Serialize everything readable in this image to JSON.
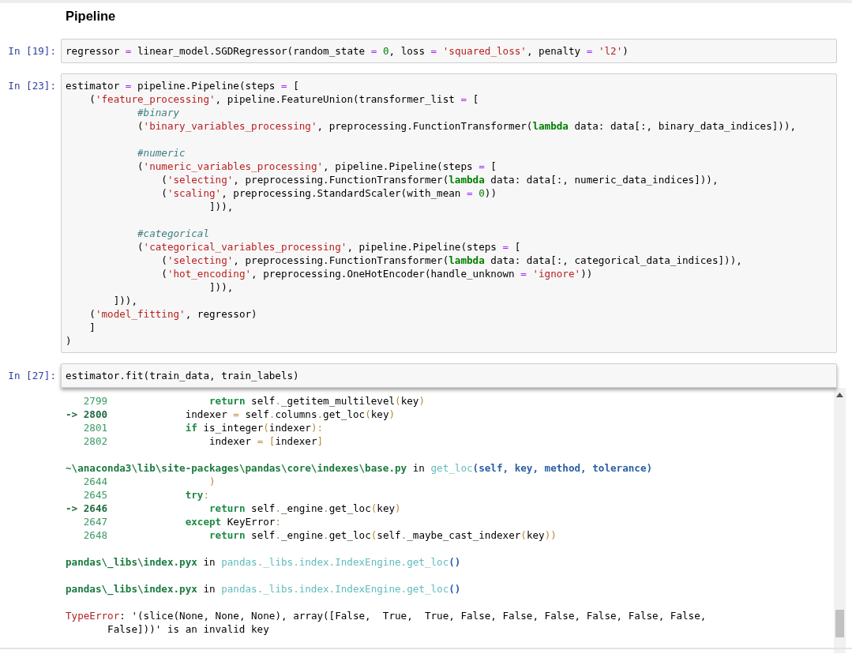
{
  "heading": "Pipeline",
  "cells": [
    {
      "prompt": "In [19]:",
      "code": "regressor = linear_model.SGDRegressor(random_state = 0, loss = 'squared_loss', penalty = 'l2')"
    },
    {
      "prompt": "In [23]:",
      "code": "estimator = pipeline.Pipeline(steps = [\n    ('feature_processing', pipeline.FeatureUnion(transformer_list = [\n            #binary\n            ('binary_variables_processing', preprocessing.FunctionTransformer(lambda data: data[:, binary_data_indices])),\n\n            #numeric\n            ('numeric_variables_processing', pipeline.Pipeline(steps = [\n                ('selecting', preprocessing.FunctionTransformer(lambda data: data[:, numeric_data_indices])),\n                ('scaling', preprocessing.StandardScaler(with_mean = 0))\n                        ])),\n\n            #categorical\n            ('categorical_variables_processing', pipeline.Pipeline(steps = [\n                ('selecting', preprocessing.FunctionTransformer(lambda data: data[:, categorical_data_indices])),\n                ('hot_encoding', preprocessing.OneHotEncoder(handle_unknown = 'ignore'))\n                        ])),\n        ])),\n    ('model_fitting', regressor)\n    ]\n)"
    },
    {
      "prompt": "In [27]:",
      "code": "estimator.fit(train_data, train_labels)"
    }
  ],
  "output": [
    {
      "kind": "frame",
      "lineno": "2799",
      "current": false,
      "code": "        return self._getitem_multilevel(key)"
    },
    {
      "kind": "frame",
      "lineno": "-> 2800",
      "current": true,
      "code": "    indexer = self.columns.get_loc(key)"
    },
    {
      "kind": "frame",
      "lineno": "2801",
      "current": false,
      "code": "    if is_integer(indexer):"
    },
    {
      "kind": "frame",
      "lineno": "2802",
      "current": false,
      "code": "        indexer = [indexer]"
    },
    {
      "kind": "blank"
    },
    {
      "kind": "location",
      "file": "~\\anaconda3\\lib\\site-packages\\pandas\\core\\indexes\\base.py",
      "connector": "in",
      "function": "get_loc",
      "args": "(self, key, method, tolerance)"
    },
    {
      "kind": "frame",
      "lineno": "2644",
      "current": false,
      "code": "        )"
    },
    {
      "kind": "frame",
      "lineno": "2645",
      "current": false,
      "code": "    try:"
    },
    {
      "kind": "frame",
      "lineno": "-> 2646",
      "current": true,
      "code": "        return self._engine.get_loc(key)"
    },
    {
      "kind": "frame",
      "lineno": "2647",
      "current": false,
      "code": "    except KeyError:"
    },
    {
      "kind": "frame",
      "lineno": "2648",
      "current": false,
      "code": "        return self._engine.get_loc(self._maybe_cast_indexer(key))"
    },
    {
      "kind": "blank"
    },
    {
      "kind": "location",
      "file": "pandas\\_libs\\index.pyx",
      "connector": "in",
      "function": "pandas._libs.index.IndexEngine.get_loc",
      "args": "()"
    },
    {
      "kind": "blank"
    },
    {
      "kind": "location",
      "file": "pandas\\_libs\\index.pyx",
      "connector": "in",
      "function": "pandas._libs.index.IndexEngine.get_loc",
      "args": "()"
    },
    {
      "kind": "blank"
    },
    {
      "kind": "error",
      "error_type": "TypeError",
      "message": ": '(slice(None, None, None), array([False,  True,  True, False, False, False, False, False, False,"
    },
    {
      "kind": "continuation",
      "text": "False]))' is an invalid key"
    }
  ]
}
